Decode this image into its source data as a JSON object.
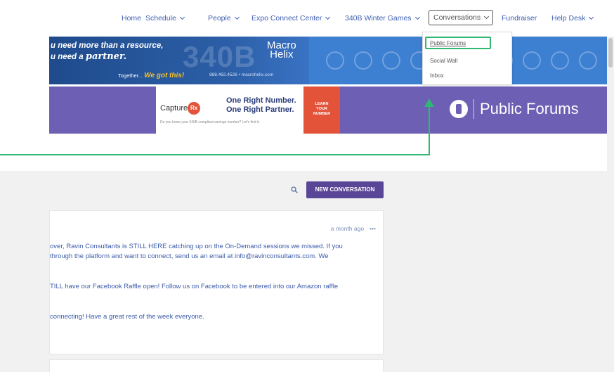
{
  "nav": {
    "home": "Home",
    "schedule": "Schedule",
    "people": "People",
    "expo": "Expo Connect Center",
    "winter_games": "340B Winter Games",
    "conversations": "Conversations",
    "fundraiser": "Fundraiser",
    "help_desk": "Help Desk"
  },
  "dropdown": {
    "items": [
      "Public Forums",
      "Social Wall",
      "Inbox"
    ]
  },
  "banner1": {
    "line1": "u need more than a resource,",
    "line2_prefix": "u need a ",
    "line2_script": "partner.",
    "watermark": "340B",
    "logo_line1": "Macro",
    "logo_line2": "Helix",
    "tagline_prefix": "Together...",
    "tagline_script": "We got this!",
    "contact": "888.462.4526  •  macrohelix.com"
  },
  "banner2": {
    "brand": "Capture",
    "brand_badge": "Rx",
    "headline1": "One Right Number.",
    "headline2": "One Right Partner.",
    "subtext": "Do you know your 340B compliant savings number? Let's find it.",
    "cta": [
      "LEARN",
      "YOUR",
      "NUMBER"
    ],
    "forum_title": "Public Forums"
  },
  "toolbar": {
    "new_conversation": "NEW CONVERSATION"
  },
  "post": {
    "time": "a month ago",
    "more": "•••",
    "lines": [
      "over, Ravin Consultants is STILL HERE catching up on the On-Demand sessions we missed. If you",
      "through the platform and want to connect, send us an email at info@ravinconsultants.com. We",
      "TILL have our Facebook Raffle open! Follow us on Facebook to be entered into our Amazon raffle",
      "connecting! Have a great rest of the week everyone."
    ]
  },
  "colors": {
    "nav_link": "#3f5fb3",
    "highlight": "#2eb872",
    "purple_button": "#5a4696"
  }
}
